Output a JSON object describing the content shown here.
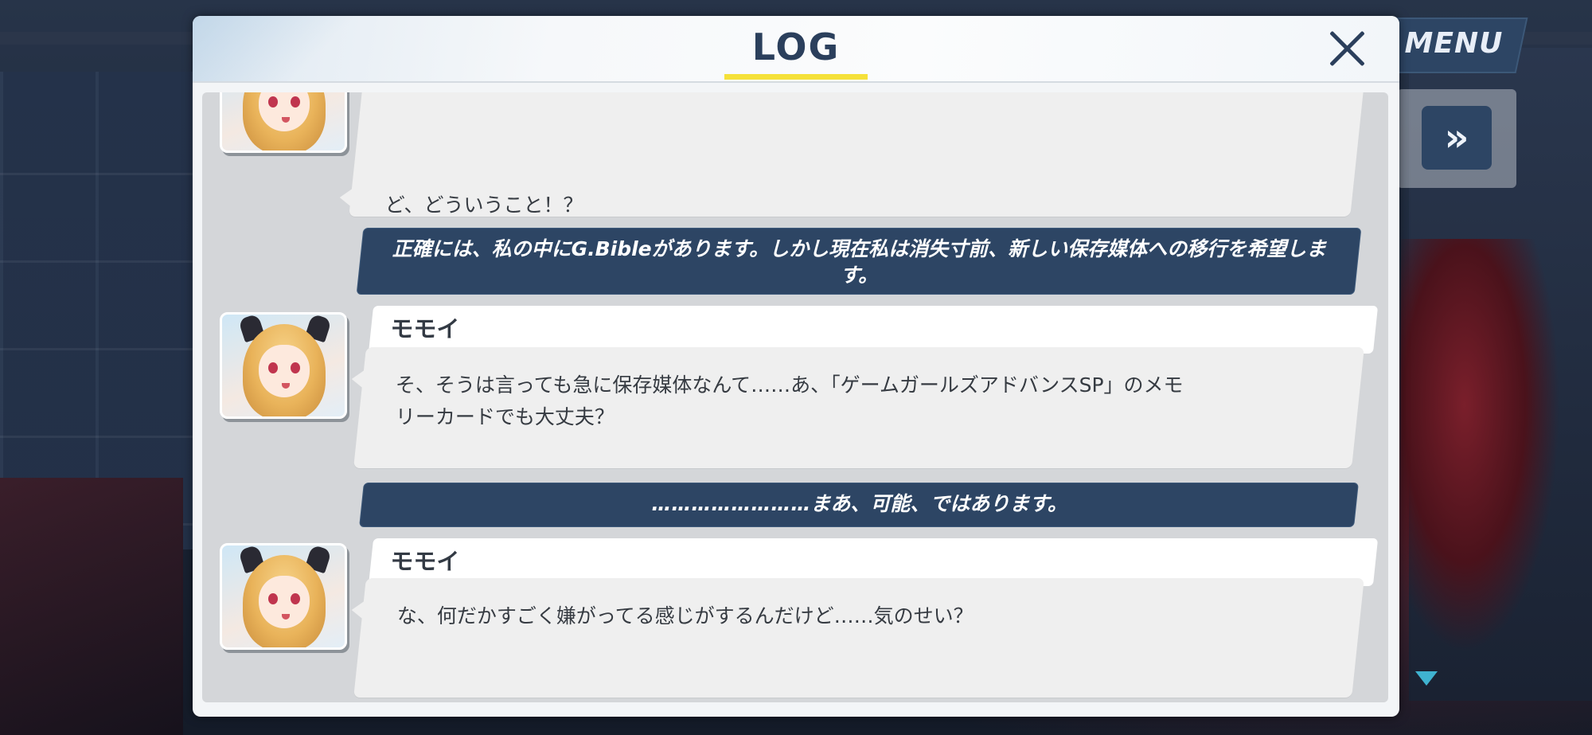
{
  "top_controls": {
    "menu_label": "MENU",
    "fast_forward_glyph": "»",
    "fast_forward_icon": "fast-forward-icon",
    "scroll_indicator_icon": "triangle-down-icon"
  },
  "dialog": {
    "title": "LOG",
    "close_icon": "close-icon"
  },
  "log_entries": [
    {
      "type": "dialogue",
      "speaker": "",
      "text": "ど、どういうこと！？"
    },
    {
      "type": "narration",
      "text": "正確には、私の中にG.Bibleがあります。しかし現在私は消失寸前、新しい保存媒体への移行を希望します。"
    },
    {
      "type": "dialogue",
      "speaker": "モモイ",
      "text_lines": [
        "そ、そうは言っても急に保存媒体なんて……あ、「ゲームガールズアドバンスSP」のメモ",
        "リーカードでも大丈夫？"
      ]
    },
    {
      "type": "narration",
      "text": "……………………まあ、可能、ではあります。"
    },
    {
      "type": "dialogue",
      "speaker": "モモイ",
      "text": "な、何だかすごく嫌がってる感じがするんだけど……気のせい？"
    }
  ],
  "colors": {
    "header_title": "#2b3f5c",
    "title_underline": "#f5e13a",
    "narration_bg": "#2d4564",
    "dialogue_bg": "#efefef",
    "scroll_indicator": "#3fb3d0"
  }
}
